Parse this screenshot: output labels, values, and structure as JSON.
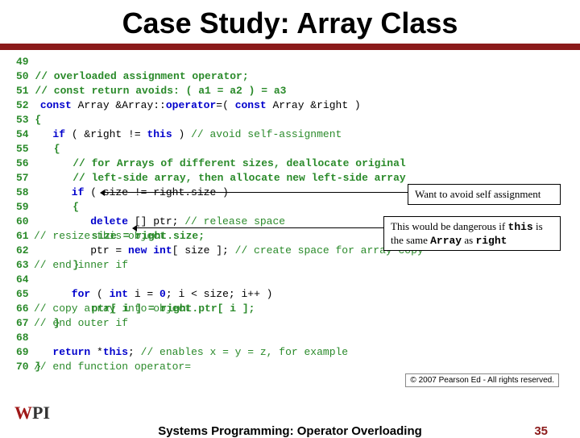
{
  "title": "Case Study: Array Class",
  "code": {
    "l49": "49",
    "l50": "50 // overloaded assignment operator;",
    "l51": "51 // const return avoids: ( a1 = a2 ) = a3",
    "l52_ln": "52",
    "l52_a": "const",
    "l52_b": " Array &Array::",
    "l52_c": "operator",
    "l52_d": "=( ",
    "l52_e": "const",
    "l52_f": " Array &right )",
    "l53": "53 {",
    "l54_ln": "54",
    "l54_a": "   if",
    "l54_b": " ( &right != ",
    "l54_c": "this",
    "l54_d": " ) ",
    "l54_e": "// avoid self-assignment",
    "l55": "55    {",
    "l56": "56       // for Arrays of different sizes, deallocate original",
    "l57": "57       // left-side array, then allocate new left-side array",
    "l58_ln": "58",
    "l58_a": "      if",
    "l58_b": " ( size != right.size )",
    "l59": "59       {",
    "l60_ln": "60",
    "l60_a": "         delete",
    "l60_b": " [] ptr; ",
    "l60_c": "// release space",
    "l61": "61          size = right.size; ",
    "l61_c": "// resize this object",
    "l62_ln": "62",
    "l62_a": "         ptr = ",
    "l62_b": "new int",
    "l62_c": "[ size ]; ",
    "l62_d": "// create space for array copy",
    "l63": "63       } ",
    "l63_c": "// end inner if",
    "l64": "64",
    "l65_ln": "65",
    "l65_a": "      for",
    "l65_b": " ( ",
    "l65_c": "int",
    "l65_d": " i = ",
    "l65_e": "0",
    "l65_f": "; i < size; i++ )",
    "l66": "66          ptr[ i ] = right.ptr[ i ]; ",
    "l66_c": "// copy array into object",
    "l67": "67    } ",
    "l67_c": "// end outer if",
    "l68": "68",
    "l69_ln": "69",
    "l69_a": "   return",
    "l69_b": " *",
    "l69_c": "this",
    "l69_d": "; ",
    "l69_e": "// enables x = y = z, for example",
    "l70": "70 } ",
    "l70_c": "// end function operator="
  },
  "callout1": "Want to avoid self assignment",
  "callout2_a": "This would be dangerous if ",
  "callout2_b": "this",
  "callout2_c": " is the same ",
  "callout2_d": "Array",
  "callout2_e": " as ",
  "callout2_f": "right",
  "copyright": "© 2007 Pearson Ed - All rights reserved.",
  "footer": "Systems Programming:   Operator Overloading",
  "page": "35"
}
